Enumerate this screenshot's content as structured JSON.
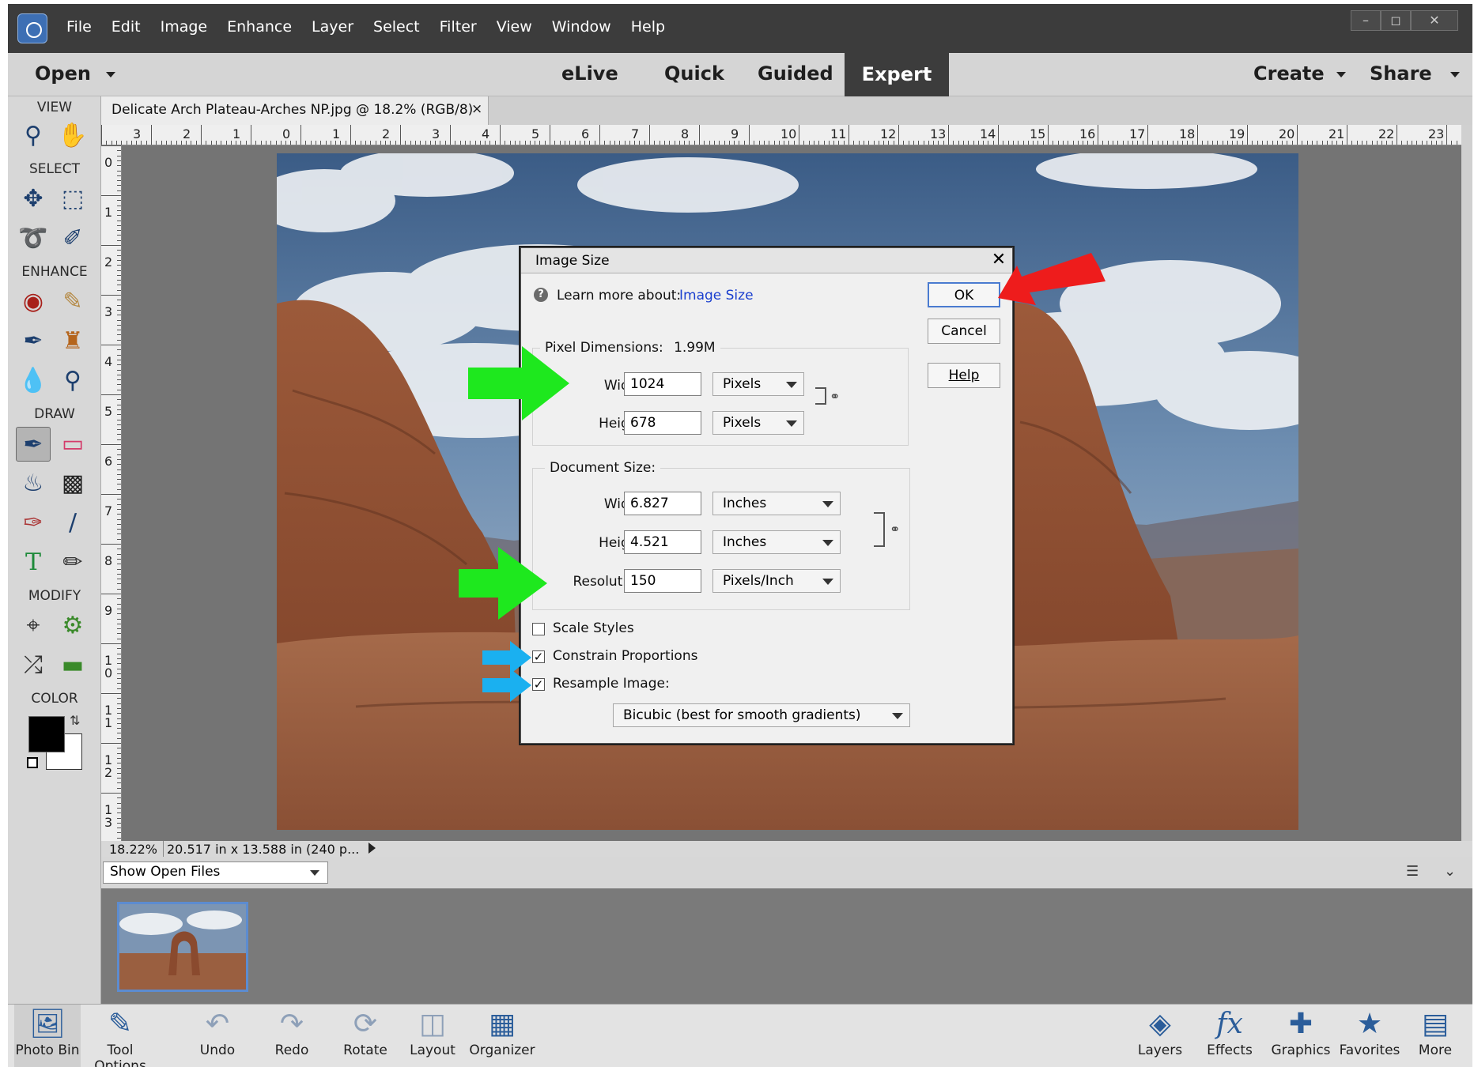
{
  "menubar": {
    "items": [
      "File",
      "Edit",
      "Image",
      "Enhance",
      "Layer",
      "Select",
      "Filter",
      "View",
      "Window",
      "Help"
    ],
    "win_min": "–",
    "win_max": "◻",
    "win_close": "✕"
  },
  "modebar": {
    "open": "Open",
    "modes": [
      "eLive",
      "Quick",
      "Guided",
      "Expert"
    ],
    "create": "Create",
    "share": "Share"
  },
  "toolbox": {
    "sections": [
      "VIEW",
      "SELECT",
      "ENHANCE",
      "DRAW",
      "MODIFY",
      "COLOR"
    ]
  },
  "doc_tab": {
    "title": "Delicate Arch Plateau-Arches NP.jpg @ 18.2% (RGB/8)",
    "close": "×"
  },
  "ruler_top": [
    "3",
    "2",
    "1",
    "0",
    "1",
    "2",
    "3",
    "4",
    "5",
    "6",
    "7",
    "8",
    "9",
    "10",
    "11",
    "12",
    "13",
    "14",
    "15",
    "16",
    "17",
    "18",
    "19",
    "20",
    "21",
    "22",
    "23"
  ],
  "ruler_left": [
    "0",
    "1",
    "2",
    "3",
    "4",
    "5",
    "6",
    "7",
    "8",
    "9",
    "1 0",
    "1 1",
    "1 2",
    "1 3"
  ],
  "status": {
    "zoom": "18.22%",
    "size": "20.517 in x 13.588 in (240 p..."
  },
  "bin": {
    "show_open": "Show Open Files"
  },
  "bottombar": {
    "items": [
      "Photo Bin",
      "Tool Options",
      "Undo",
      "Redo",
      "Rotate",
      "Layout",
      "Organizer"
    ],
    "right_items": [
      "Layers",
      "Effects",
      "Graphics",
      "Favorites",
      "More"
    ]
  },
  "dialog": {
    "title": "Image Size",
    "close": "✕",
    "learn": "Learn more about:",
    "learn_link": "Image Size",
    "ok": "OK",
    "cancel": "Cancel",
    "help": "Help",
    "pixel_dims_label": "Pixel Dimensions:",
    "pixel_dims_value": "1.99M",
    "width_label": "Width:",
    "height_label": "Height:",
    "px_width": "1024",
    "px_height": "678",
    "px_unit_w": "Pixels",
    "px_unit_h": "Pixels",
    "doc_size_label": "Document Size:",
    "doc_width": "6.827",
    "doc_height": "4.521",
    "doc_unit_w": "Inches",
    "doc_unit_h": "Inches",
    "resolution_label": "Resolution:",
    "resolution": "150",
    "res_unit": "Pixels/Inch",
    "scale_styles": "Scale Styles",
    "constrain": "Constrain Proportions",
    "resample": "Resample Image:",
    "resample_method": "Bicubic (best for smooth gradients)"
  },
  "colors": {
    "accent_green": "#1ee81e",
    "accent_red": "#ee1c1c",
    "accent_blue": "#1ab0f0"
  }
}
